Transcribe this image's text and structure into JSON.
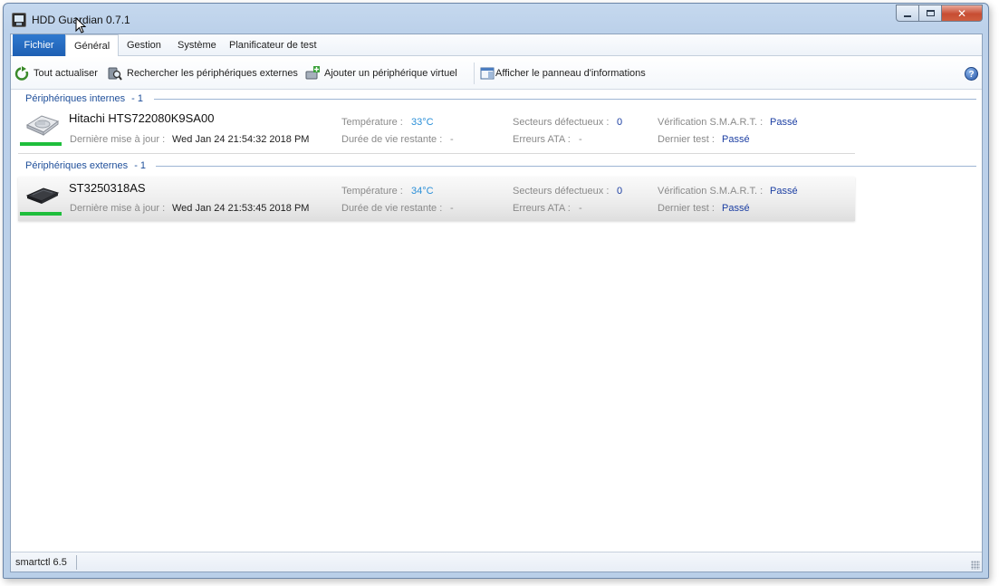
{
  "window": {
    "title": "HDD Guardian 0.7.1",
    "controls": {
      "minimize": "",
      "maximize": "",
      "close": "✕"
    }
  },
  "ribbon": {
    "tabs": [
      {
        "label": "Fichier"
      },
      {
        "label": "Général"
      },
      {
        "label": "Gestion"
      },
      {
        "label": "Système"
      },
      {
        "label": "Planificateur de test"
      }
    ],
    "active_tab": "Général",
    "commands": [
      {
        "label": "Tout actualiser",
        "icon": "refresh-icon"
      },
      {
        "label": "Rechercher les périphériques externes",
        "icon": "search-device-icon"
      },
      {
        "label": "Ajouter un périphérique virtuel",
        "icon": "add-virtual-device-icon"
      },
      {
        "label": "Afficher le panneau d'informations",
        "icon": "info-panel-icon"
      }
    ],
    "help": "?"
  },
  "sections": {
    "internal": {
      "title": "Périphériques internes",
      "count": "- 1",
      "device": {
        "name": "Hitachi HTS722080K9SA00",
        "icon": "hard-drive-icon",
        "last_update_label": "Dernière mise à jour :",
        "last_update": "Wed Jan 24 21:54:32 2018 PM",
        "temperature_label": "Température :",
        "temperature": "33°C",
        "lifetime_label": "Durée de vie restante :",
        "lifetime": "-",
        "bad_sectors_label": "Secteurs défectueux :",
        "bad_sectors": "0",
        "ata_errors_label": "Erreurs ATA :",
        "ata_errors": "-",
        "smart_label": "Vérification S.M.A.R.T. :",
        "smart": "Passé",
        "last_test_label": "Dernier test :",
        "last_test": "Passé",
        "health_color": "#1fbe3c"
      }
    },
    "external": {
      "title": "Périphériques externes",
      "count": "- 1",
      "device": {
        "name": "ST3250318AS",
        "icon": "external-drive-icon",
        "last_update_label": "Dernière mise à jour :",
        "last_update": "Wed Jan 24 21:53:45 2018 PM",
        "temperature_label": "Température :",
        "temperature": "34°C",
        "lifetime_label": "Durée de vie restante :",
        "lifetime": "-",
        "bad_sectors_label": "Secteurs défectueux :",
        "bad_sectors": "0",
        "ata_errors_label": "Erreurs ATA :",
        "ata_errors": "-",
        "smart_label": "Vérification S.M.A.R.T. :",
        "smart": "Passé",
        "last_test_label": "Dernier test :",
        "last_test": "Passé",
        "health_color": "#1fbe3c"
      }
    }
  },
  "statusbar": {
    "text": "smartctl 6.5"
  },
  "colors": {
    "accent": "#1e5fb3",
    "section_title": "#1f4f9a",
    "value_blue": "#1c3fa3",
    "temperature": "#2a8fd8",
    "health_ok": "#1fbe3c"
  }
}
